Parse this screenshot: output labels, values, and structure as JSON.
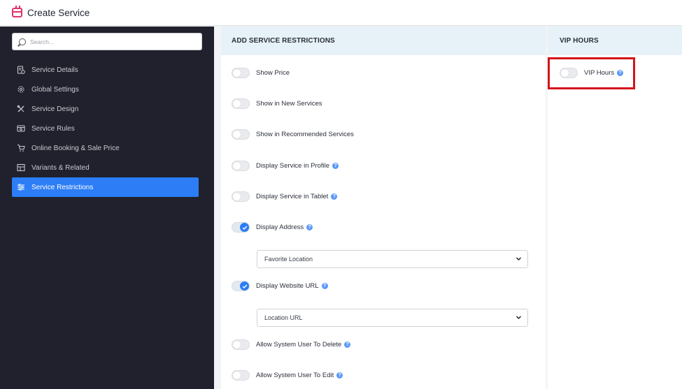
{
  "app": {
    "title": "Create Service",
    "icon": "calendar-icon",
    "accent": "#e0336b"
  },
  "search": {
    "placeholder": "Search..."
  },
  "sidebar": {
    "items": [
      {
        "label": "Service Details",
        "icon": "document-info-icon",
        "active": false
      },
      {
        "label": "Global Settings",
        "icon": "gear-icon",
        "active": false
      },
      {
        "label": "Service Design",
        "icon": "design-tools-icon",
        "active": false
      },
      {
        "label": "Service Rules",
        "icon": "rules-icon",
        "active": false
      },
      {
        "label": "Online Booking & Sale Price",
        "icon": "cart-icon",
        "active": false
      },
      {
        "label": "Variants & Related",
        "icon": "grid-icon",
        "active": false
      },
      {
        "label": "Service Restrictions",
        "icon": "sliders-icon",
        "active": true
      }
    ]
  },
  "restrictions": {
    "header": "ADD SERVICE RESTRICTIONS",
    "rows": [
      {
        "label": "Show Price",
        "on": false,
        "help": false
      },
      {
        "label": "Show in New Services",
        "on": false,
        "help": false
      },
      {
        "label": "Show in Recommended Services",
        "on": false,
        "help": false
      },
      {
        "label": "Display Service in Profile",
        "on": false,
        "help": true
      },
      {
        "label": "Display Service in Tablet",
        "on": false,
        "help": true
      },
      {
        "label": "Display Address",
        "on": true,
        "help": true
      },
      {
        "label": "Display Website URL",
        "on": true,
        "help": true
      },
      {
        "label": "Allow System User To Delete",
        "on": false,
        "help": true
      },
      {
        "label": "Allow System User To Edit",
        "on": false,
        "help": true
      }
    ],
    "address_select": "Favorite Location",
    "url_select": "Location URL"
  },
  "vip": {
    "header": "VIP HOURS",
    "toggle_label": "VIP Hours",
    "on": false,
    "help": true
  },
  "colors": {
    "primary": "#2c7df6",
    "sidebar_bg": "#20212c",
    "highlight": "#d4141b"
  }
}
